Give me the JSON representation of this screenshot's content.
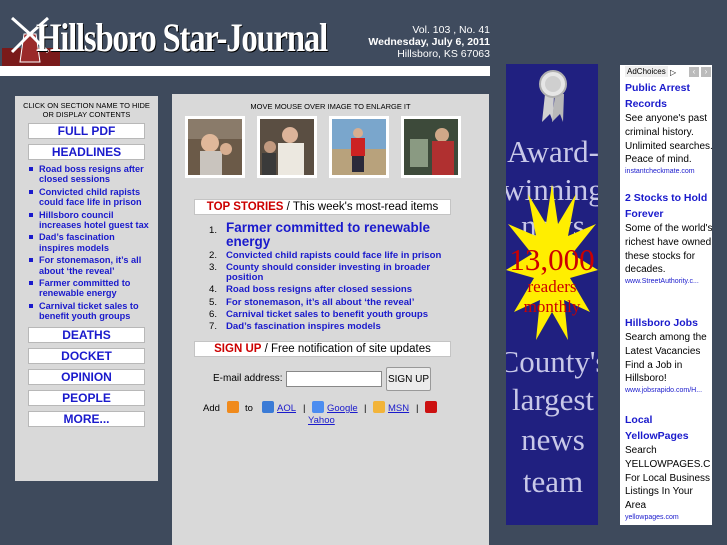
{
  "masthead": {
    "brand": "Hillsboro Star-Journal",
    "volume": "Vol. 103 , No. 41",
    "date": "Wednesday, July 6, 2011",
    "location": "Hillsboro, KS 67063"
  },
  "left_panel": {
    "hint": "CLICK ON SECTION NAME TO HIDE OR DISPLAY CONTENTS",
    "full_pdf": "FULL PDF",
    "headlines": "HEADLINES",
    "headline_items": [
      "Road boss resigns after closed sessions",
      "Convicted child rapists could face life in prison",
      "Hillsboro council increases hotel guest tax",
      "Dad’s fascination inspires models",
      "For stonemason, it’s all about ‘the reveal’",
      "Farmer committed to renewable energy",
      "Carnival ticket sales to benefit youth groups"
    ],
    "sections": [
      "DEATHS",
      "DOCKET",
      "OPINION",
      "PEOPLE",
      "MORE..."
    ]
  },
  "center": {
    "hover_hint": "MOVE MOUSE OVER IMAGE TO ENLARGE IT",
    "thumbnails": [
      "photo-child-portrait",
      "photo-men-group",
      "photo-man-red-shirt",
      "photo-man-working"
    ],
    "top_stories_label": "TOP STORIES",
    "top_stories_sub": " / This week's most-read items",
    "stories": [
      {
        "n": "1.",
        "title": "Farmer committed to renewable energy"
      },
      {
        "n": "2.",
        "title": "Convicted child rapists could face life in prison"
      },
      {
        "n": "3.",
        "title": "County should consider investing in broader position"
      },
      {
        "n": "4.",
        "title": "Road boss resigns after closed sessions"
      },
      {
        "n": "5.",
        "title": "For stonemason, it’s all about ‘the reveal’"
      },
      {
        "n": "6.",
        "title": "Carnival ticket sales to benefit youth groups"
      },
      {
        "n": "7.",
        "title": "Dad’s fascination inspires models"
      }
    ],
    "signup_label": "SIGN UP",
    "signup_sub": " / Free notification of site updates",
    "email_label": "E-mail address:",
    "email_value": "",
    "signup_button": "SIGN UP",
    "add_label": "Add",
    "to_label": "to",
    "aol": "AOL",
    "google": "Google",
    "msn": "MSN",
    "yahoo": "Yahoo",
    "sep": "|"
  },
  "banner": {
    "line1": "Award-",
    "line2": "winning",
    "line3": "news",
    "burst_number": "13,000",
    "burst_line1": "readers",
    "burst_line2": "monthly",
    "line4": "County's",
    "line5": "largest",
    "line6": "news",
    "line7": "team",
    "colors": {
      "bg": "#202080",
      "text": "#c8c8e8",
      "burst": "#ffee00",
      "burst_text": "#cc0000"
    }
  },
  "text_ads": {
    "adchoices": "AdChoices",
    "ads": [
      {
        "title": "Public Arrest Records",
        "body": "See anyone's past criminal history. Unlimited searches. Peace of mind.",
        "url": "instantcheckmate.com"
      },
      {
        "title": "2 Stocks to Hold Forever",
        "body": "Some of the world's richest have owned these stocks for decades.",
        "url": "www.StreetAuthority.c..."
      },
      {
        "title": "Hillsboro Jobs",
        "body": "Search among the Latest Vacancies Find a Job in Hillsboro!",
        "url": "www.jobsrapido.com/H..."
      },
      {
        "title": "Local YellowPages",
        "body": "Search YELLOWPAGES.C For Local Business Listings In Your Area",
        "url": "yellowpages.com"
      }
    ]
  }
}
